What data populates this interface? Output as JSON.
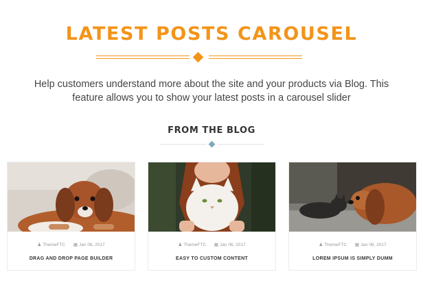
{
  "header": {
    "title": "LATEST POSTS CAROUSEL",
    "description": "Help customers understand more about the site and your products via Blog. This feature allows you to show your latest posts in a carousel slider",
    "accent_color": "#f39419"
  },
  "blog": {
    "title": "FROM THE BLOG",
    "accent_color": "#7fa8bd"
  },
  "posts": [
    {
      "author": "ThemeFTC",
      "date": "Jan 06, 2017",
      "title": "DRAG AND DROP PAGE BUILDER",
      "image": "puppy-lying-photo"
    },
    {
      "author": "ThemeFTC",
      "date": "Jan 06, 2017",
      "title": "EASY TO CUSTOM CONTENT",
      "image": "girl-holding-white-cat-photo"
    },
    {
      "author": "ThemeFTC",
      "date": "Jan 06, 2017",
      "title": "LOREM IPSUM IS SIMPLY DUMM",
      "image": "dog-and-cat-photo"
    }
  ],
  "icons": {
    "author": "user-icon",
    "date": "calendar-icon"
  }
}
